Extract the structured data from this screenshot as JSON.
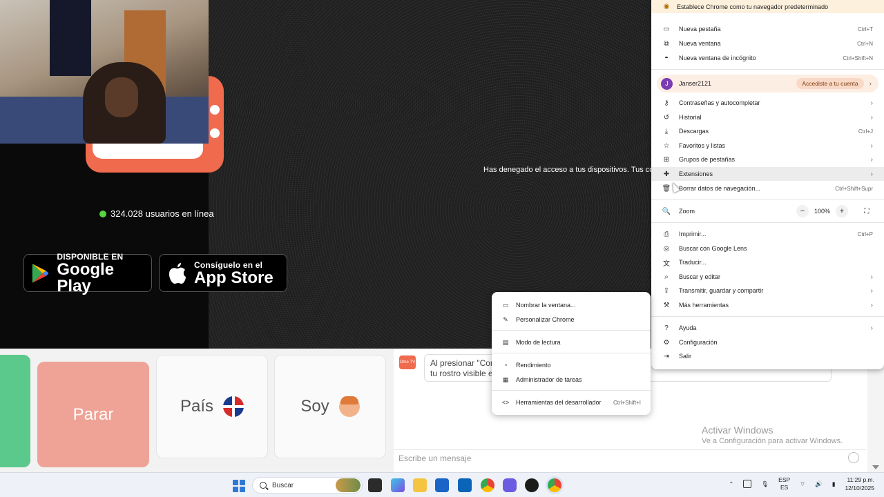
{
  "stage": {
    "online_text": "324.028 usuarios en línea",
    "denied_text": "Has denegado el acceso a tus dispositivos. Tus comp"
  },
  "stores": {
    "google": {
      "small": "DISPONIBLE EN",
      "big": "Google Play"
    },
    "apple": {
      "small": "Consíguelo en el",
      "big": "App Store"
    }
  },
  "controls": {
    "stop_label": "Parar",
    "country_label": "País",
    "soy_label": "Soy"
  },
  "chat": {
    "logo_text": "Ome TV",
    "bubble_line1": "Al presionar \"Com",
    "bubble_line2": "tu rostro visible en",
    "input_placeholder": "Escribe un mensaje"
  },
  "watermark": {
    "title": "Activar Windows",
    "subtitle": "Ve a Configuración para activar Windows."
  },
  "chrome_menu": {
    "banner": "Establece Chrome como tu navegador predeterminado",
    "group1": [
      {
        "label": "Nueva pestaña",
        "shortcut": "Ctrl+T"
      },
      {
        "label": "Nueva ventana",
        "shortcut": "Ctrl+N"
      },
      {
        "label": "Nueva ventana de incógnito",
        "shortcut": "Ctrl+Shift+N"
      }
    ],
    "profile": {
      "initial": "J",
      "name": "Janser2121",
      "action": "Accediste a tu cuenta"
    },
    "group2": [
      {
        "label": "Contraseñas y autocompletar",
        "shortcut": ""
      },
      {
        "label": "Historial",
        "shortcut": ""
      },
      {
        "label": "Descargas",
        "shortcut": "Ctrl+J"
      },
      {
        "label": "Favoritos y listas",
        "shortcut": ""
      },
      {
        "label": "Grupos de pestañas",
        "shortcut": ""
      },
      {
        "label": "Extensiones",
        "shortcut": ""
      },
      {
        "label": "Borrar datos de navegación...",
        "shortcut": "Ctrl+Shift+Supr"
      }
    ],
    "zoom": {
      "label": "Zoom",
      "value": "100%",
      "minus": "−",
      "plus": "+"
    },
    "group3": [
      {
        "label": "Imprimir...",
        "shortcut": "Ctrl+P"
      },
      {
        "label": "Buscar con Google Lens",
        "shortcut": ""
      },
      {
        "label": "Traducir...",
        "shortcut": ""
      },
      {
        "label": "Buscar y editar",
        "shortcut": ""
      },
      {
        "label": "Transmitir, guardar y compartir",
        "shortcut": ""
      },
      {
        "label": "Más herramientas",
        "shortcut": ""
      }
    ],
    "group4": [
      {
        "label": "Ayuda",
        "shortcut": ""
      },
      {
        "label": "Configuración",
        "shortcut": ""
      },
      {
        "label": "Salir",
        "shortcut": ""
      }
    ]
  },
  "more_tools_submenu": [
    {
      "label": "Nombrar la ventana...",
      "shortcut": ""
    },
    {
      "label": "Personalizar Chrome",
      "shortcut": ""
    },
    {
      "label": "Modo de lectura",
      "shortcut": ""
    },
    {
      "label": "Rendimiento",
      "shortcut": ""
    },
    {
      "label": "Administrador de tareas",
      "shortcut": ""
    },
    {
      "label": "Herramientas del desarrollador",
      "shortcut": "Ctrl+Shift+I"
    }
  ],
  "taskbar": {
    "search_placeholder": "Buscar",
    "lang_top": "ESP",
    "lang_bottom": "ES",
    "time": "11:29 p.m.",
    "date": "12/10/2025"
  },
  "colors": {
    "accent_orange": "#f06a4d",
    "online_green": "#57d63b",
    "stop_button": "#eea396",
    "profile_bg": "#fdeee4"
  }
}
